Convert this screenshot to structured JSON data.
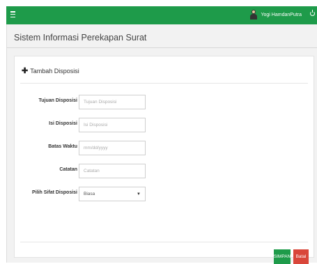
{
  "header": {
    "user_name": "Yogi HamdanPutra"
  },
  "page": {
    "title": "Sistem Informasi Perekapan Surat"
  },
  "form": {
    "heading": "Tambah Disposisi",
    "fields": {
      "tujuan": {
        "label": "Tujuan Disposisi",
        "placeholder": "Tujuan Disposisi",
        "value": ""
      },
      "isi": {
        "label": "Isi Disposisi",
        "placeholder": "Isi Disposisi",
        "value": ""
      },
      "batas": {
        "label": "Batas Waktu",
        "placeholder": "mm/dd/yyyy",
        "value": ""
      },
      "catatan": {
        "label": "Catatan",
        "placeholder": "Catatan",
        "value": ""
      },
      "sifat": {
        "label": "Pilih Sifat Disposisi",
        "selected": "Biasa"
      }
    },
    "buttons": {
      "save": "SIMPAN",
      "cancel": "Batal"
    }
  },
  "colors": {
    "topbar": "#1e9b4a",
    "save_button": "#1e9b4a",
    "cancel_button": "#d9463a"
  },
  "icons": [
    "menu-icon",
    "avatar",
    "power-icon",
    "plus-icon",
    "chevron-down-icon"
  ]
}
